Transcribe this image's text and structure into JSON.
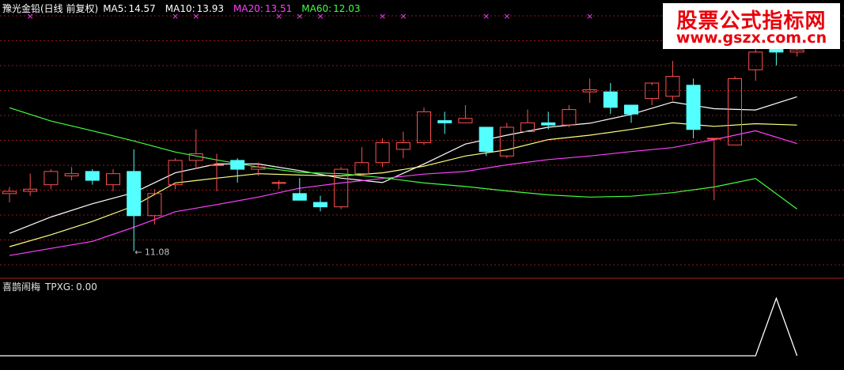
{
  "header": {
    "name": "豫光金铅(日线 前复权)",
    "ma5_label": "MA5:",
    "ma5_value": "14.57",
    "ma10_label": "MA10:",
    "ma10_value": "13.93",
    "ma20_label": "MA20:",
    "ma20_value": "13.51",
    "ma60_label": "MA60:",
    "ma60_value": "12.03"
  },
  "indicator": {
    "name": "喜鹊闹梅",
    "label": "TPXG:",
    "value": "0.00"
  },
  "logo": {
    "line1": "股票公式指标网",
    "line2": "www.gszx.com.cn"
  },
  "colors": {
    "background": "#000000",
    "up_candle": "#ff5050",
    "down_candle": "#54ffff",
    "ma5": "#ffffff",
    "ma10": "#ffff80",
    "ma20": "#ff40ff",
    "ma60": "#40ff40",
    "grid": "#8b1a1a",
    "separator": "#b02020",
    "marker": "#ff40ff",
    "annotation": "#c0c0c0",
    "indicator_line": "#ffffff",
    "header_name": "#ffffff",
    "header_label": "#ffffff",
    "logo_text": "#e8000b"
  },
  "chart_data": [
    {
      "type": "candlestick",
      "title": "豫光金铅(日线 前复权)",
      "ylim": [
        10.5,
        16.4
      ],
      "low_annotation": "← 11.08",
      "low_annotation_index": 6,
      "marker_symbol": "×",
      "marker_indices": [
        1,
        8,
        9,
        13,
        14,
        15,
        18,
        19,
        23,
        24,
        28
      ],
      "candles": [
        {
          "o": 12.38,
          "h": 12.53,
          "l": 12.18,
          "c": 12.43
        },
        {
          "o": 12.43,
          "h": 12.83,
          "l": 12.33,
          "c": 12.48
        },
        {
          "o": 12.58,
          "h": 12.93,
          "l": 12.48,
          "c": 12.88
        },
        {
          "o": 12.78,
          "h": 12.98,
          "l": 12.68,
          "c": 12.83
        },
        {
          "o": 12.88,
          "h": 12.93,
          "l": 12.58,
          "c": 12.68
        },
        {
          "o": 12.58,
          "h": 12.93,
          "l": 12.43,
          "c": 12.83
        },
        {
          "o": 12.88,
          "h": 13.38,
          "l": 11.08,
          "c": 11.88
        },
        {
          "o": 11.88,
          "h": 12.48,
          "l": 11.68,
          "c": 12.38
        },
        {
          "o": 12.58,
          "h": 13.18,
          "l": 12.48,
          "c": 13.13
        },
        {
          "o": 13.13,
          "h": 13.83,
          "l": 12.93,
          "c": 13.28
        },
        {
          "o": 13.03,
          "h": 13.28,
          "l": 12.43,
          "c": 13.03
        },
        {
          "o": 13.13,
          "h": 13.18,
          "l": 12.63,
          "c": 12.93
        },
        {
          "o": 12.93,
          "h": 13.08,
          "l": 12.78,
          "c": 12.98
        },
        {
          "o": 12.63,
          "h": 12.68,
          "l": 12.48,
          "c": 12.63
        },
        {
          "o": 12.38,
          "h": 12.73,
          "l": 12.23,
          "c": 12.23
        },
        {
          "o": 12.18,
          "h": 12.33,
          "l": 11.98,
          "c": 12.08
        },
        {
          "o": 12.08,
          "h": 12.98,
          "l": 12.03,
          "c": 12.93
        },
        {
          "o": 12.83,
          "h": 13.43,
          "l": 12.78,
          "c": 13.08
        },
        {
          "o": 13.08,
          "h": 13.63,
          "l": 12.98,
          "c": 13.53
        },
        {
          "o": 13.38,
          "h": 13.78,
          "l": 13.18,
          "c": 13.53
        },
        {
          "o": 13.53,
          "h": 14.33,
          "l": 13.48,
          "c": 14.23
        },
        {
          "o": 14.03,
          "h": 14.23,
          "l": 13.73,
          "c": 13.98
        },
        {
          "o": 13.98,
          "h": 14.38,
          "l": 13.98,
          "c": 14.08
        },
        {
          "o": 13.88,
          "h": 13.88,
          "l": 13.23,
          "c": 13.33
        },
        {
          "o": 13.23,
          "h": 13.98,
          "l": 13.18,
          "c": 13.88
        },
        {
          "o": 13.78,
          "h": 14.28,
          "l": 13.78,
          "c": 13.98
        },
        {
          "o": 13.98,
          "h": 14.23,
          "l": 13.83,
          "c": 13.93
        },
        {
          "o": 13.93,
          "h": 14.38,
          "l": 13.88,
          "c": 14.28
        },
        {
          "o": 14.68,
          "h": 14.98,
          "l": 14.43,
          "c": 14.73
        },
        {
          "o": 14.68,
          "h": 14.88,
          "l": 14.18,
          "c": 14.33
        },
        {
          "o": 14.38,
          "h": 14.38,
          "l": 13.98,
          "c": 14.18
        },
        {
          "o": 14.53,
          "h": 14.83,
          "l": 14.38,
          "c": 14.88
        },
        {
          "o": 14.58,
          "h": 15.38,
          "l": 14.48,
          "c": 15.03
        },
        {
          "o": 14.83,
          "h": 14.98,
          "l": 13.63,
          "c": 13.83
        },
        {
          "o": 13.63,
          "h": 13.63,
          "l": 12.23,
          "c": 13.63
        },
        {
          "o": 13.48,
          "h": 15.03,
          "l": 13.48,
          "c": 14.98
        },
        {
          "o": 15.18,
          "h": 15.88,
          "l": 14.93,
          "c": 15.58
        },
        {
          "o": 15.78,
          "h": 15.78,
          "l": 15.28,
          "c": 15.58
        },
        {
          "o": 15.58,
          "h": 15.98,
          "l": 15.48,
          "c": 15.63
        }
      ],
      "series": [
        {
          "name": "MA5",
          "values": [
            11.48,
            null,
            11.85,
            null,
            12.15,
            null,
            12.4,
            null,
            12.85,
            null,
            13.05,
            null,
            13.05,
            null,
            12.9,
            null,
            12.73,
            null,
            12.63,
            null,
            13.05,
            null,
            13.5,
            null,
            13.7,
            null,
            13.88,
            null,
            13.97,
            null,
            14.17,
            null,
            14.45,
            null,
            14.3,
            null,
            14.27,
            null,
            14.57
          ]
        },
        {
          "name": "MA10",
          "values": [
            11.18,
            null,
            11.45,
            null,
            11.75,
            null,
            12.1,
            null,
            12.62,
            null,
            12.73,
            null,
            12.83,
            null,
            12.8,
            null,
            12.78,
            null,
            12.85,
            null,
            13.0,
            null,
            13.23,
            null,
            13.37,
            null,
            13.6,
            null,
            13.7,
            null,
            13.83,
            null,
            13.98,
            null,
            13.9,
            null,
            13.96,
            null,
            13.93
          ]
        },
        {
          "name": "MA20",
          "values": [
            10.98,
            null,
            11.14,
            null,
            11.3,
            null,
            11.62,
            null,
            11.97,
            null,
            12.13,
            null,
            12.3,
            null,
            12.5,
            null,
            12.62,
            null,
            12.72,
            null,
            12.82,
            null,
            12.88,
            null,
            13.03,
            null,
            13.15,
            null,
            13.23,
            null,
            13.33,
            null,
            13.42,
            null,
            13.6,
            null,
            13.8,
            null,
            13.51
          ]
        },
        {
          "name": "MA60",
          "values": [
            14.32,
            null,
            14.02,
            null,
            13.8,
            null,
            13.57,
            null,
            13.32,
            null,
            13.14,
            null,
            12.98,
            null,
            12.86,
            null,
            12.83,
            null,
            12.74,
            null,
            12.62,
            null,
            12.54,
            null,
            12.44,
            null,
            12.35,
            null,
            12.3,
            null,
            12.32,
            null,
            12.4,
            null,
            12.53,
            null,
            12.72,
            null,
            12.03
          ]
        }
      ]
    },
    {
      "type": "line",
      "title": "TPXG",
      "ylim": [
        0,
        1.1
      ],
      "series": [
        {
          "name": "TPXG",
          "values": [
            0,
            0,
            0,
            0,
            0,
            0,
            0,
            0,
            0,
            0,
            0,
            0,
            0,
            0,
            0,
            0,
            0,
            0,
            0,
            0,
            0,
            0,
            0,
            0,
            0,
            0,
            0,
            0,
            0,
            0,
            0,
            0,
            0,
            0,
            0,
            0,
            0,
            1,
            0
          ]
        }
      ]
    }
  ]
}
